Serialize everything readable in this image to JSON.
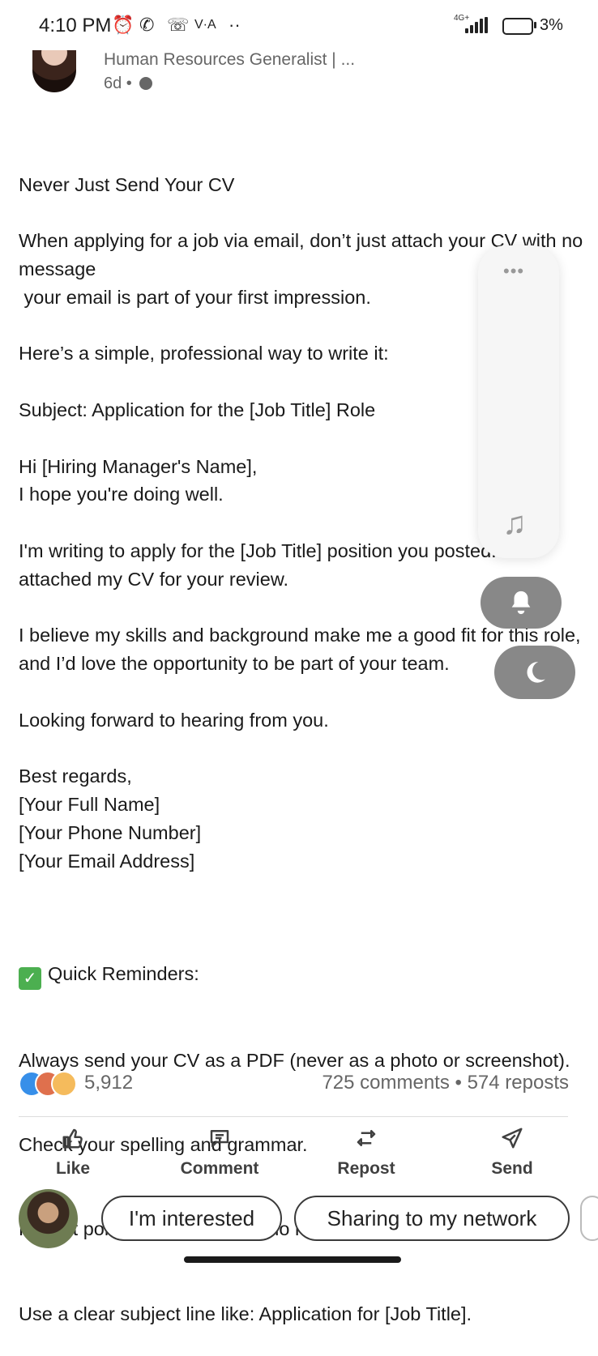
{
  "status_bar": {
    "time": "4:10 PM",
    "network": "4G+",
    "battery": "3%",
    "carrier_text": "V·A",
    "more": "··"
  },
  "post": {
    "author_headline": "Human Resources Generalist | ...",
    "time_ago": "6d •",
    "paragraphs": [
      "Never Just Send Your CV",
      "",
      "When applying for a job via email, don’t just attach your CV with no message",
      " your email is part of your first impression.",
      "",
      "Here’s a simple, professional way to write it:",
      "",
      "Subject: Application for the [Job Title] Role",
      "",
      "Hi [Hiring Manager's Name],",
      "I hope you're doing well.",
      "",
      "I'm writing to apply for the [Job Title] position you posted. I’ve attached my CV for your review.",
      "",
      "I believe my skills and background make me a good fit for this role, and I’d love the opportunity to be part of your team.",
      "",
      "Looking forward to hearing from you.",
      "",
      "Best regards,",
      "[Your Full Name]",
      "[Your Phone Number]",
      "[Your Email Address]",
      ""
    ],
    "reminders_title": "Quick Reminders:",
    "reminders": [
      "Always send your CV as a PDF (never as a photo or screenshot).",
      "Check your spelling and grammar.",
      "Keep it polite and simple and no need for long paragraphs.",
      "Use a clear subject line like: Application for [Job Title]."
    ]
  },
  "social": {
    "reactions": "5,912",
    "engagement": "725 comments • 574 reposts"
  },
  "actions": {
    "like": "Like",
    "comment": "Comment",
    "repost": "Repost",
    "send": "Send"
  },
  "quick_replies": {
    "interested": "I'm interested",
    "sharing": "Sharing to my network"
  },
  "colors": {
    "linkedin_blue": "#0a66c2",
    "text": "#1a1a1a",
    "muted": "#666666",
    "like_blue": "#378fe9",
    "love_red": "#df704d",
    "insight_yellow": "#f5bb5c"
  },
  "icons": [
    "alarm-icon",
    "whatsapp-icon",
    "missed-call-icon",
    "globe-icon",
    "signal-icon",
    "battery-icon",
    "like-icon",
    "comment-icon",
    "repost-icon",
    "send-icon",
    "music-icon",
    "bell-icon",
    "moon-icon"
  ]
}
